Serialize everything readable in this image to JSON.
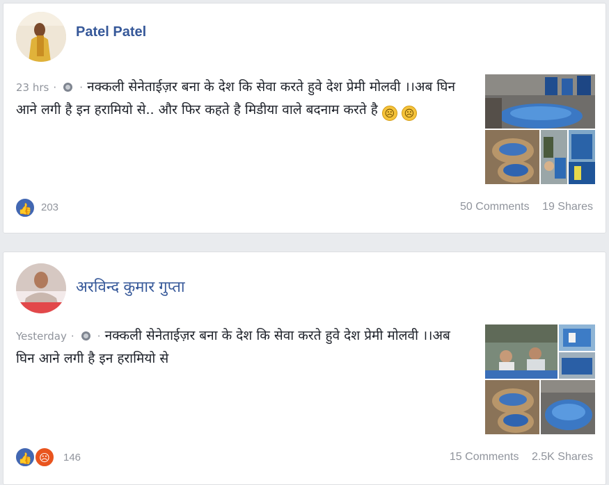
{
  "posts": [
    {
      "author": "Patel Patel",
      "timestamp": "23 hrs",
      "text": "नक्कली सेनेताईज़र बना के देश कि सेवा करते हुवे देश प्रेमी मोलवी ।।अब घिन आने लगी है इन हरामियो से.. और फिर कहते है मिडीया वाले बदनाम करते है",
      "reaction_count": "203",
      "comments": "50 Comments",
      "shares": "19 Shares",
      "reactions": [
        "like-icon"
      ]
    },
    {
      "author": "अरविन्द कुमार गुप्ता",
      "timestamp": "Yesterday",
      "text": "नक्कली सेनेताईज़र बना के देश कि सेवा करते हुवे देश प्रेमी मोलवी ।।अब घिन आने लगी है इन हरामियो से",
      "reaction_count": "146",
      "comments": "15 Comments",
      "shares": "2.5K Shares",
      "reactions": [
        "like-icon",
        "angry-icon"
      ]
    }
  ],
  "ui": {
    "separator": "·"
  },
  "colors": {
    "link": "#365899",
    "muted": "#90949c",
    "like": "#4267b2",
    "angry": "#e9541e"
  }
}
